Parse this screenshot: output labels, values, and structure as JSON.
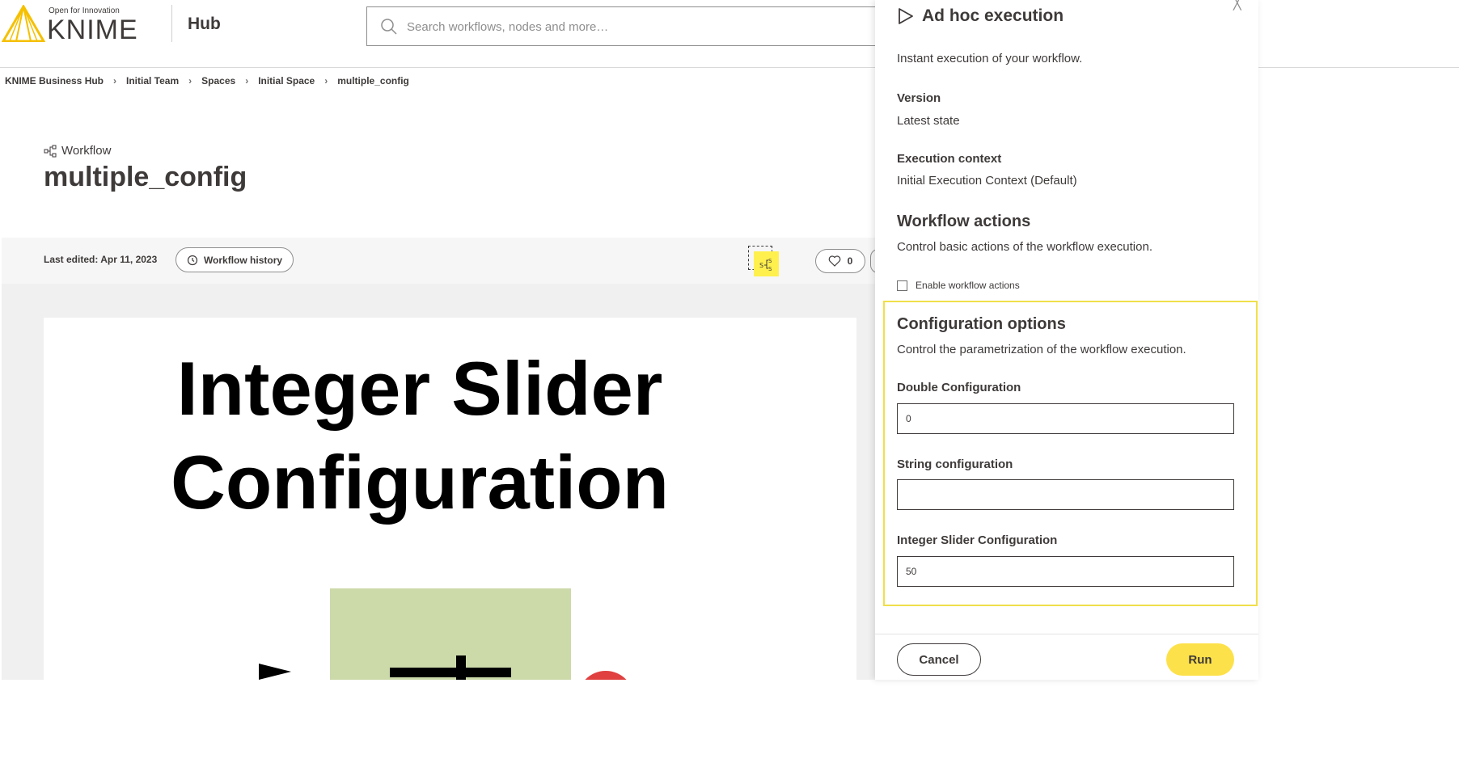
{
  "header": {
    "logo_tagline": "Open for Innovation",
    "logo_word": "KNIME",
    "hub_label": "Hub",
    "search_placeholder": "Search workflows, nodes and more…"
  },
  "breadcrumb": [
    "KNIME Business Hub",
    "Initial Team",
    "Spaces",
    "Initial Space",
    "multiple_config"
  ],
  "item": {
    "type": "Workflow",
    "title": "multiple_config",
    "last_edited": "Last edited: Apr 11, 2023",
    "history_label": "Workflow history",
    "likes": "0"
  },
  "preview": {
    "line1": "Integer Slider",
    "line2": "Configuration"
  },
  "panel": {
    "title": "Ad hoc execution",
    "subtitle": "Instant execution of your workflow.",
    "version_label": "Version",
    "version_value": "Latest state",
    "context_label": "Execution context",
    "context_value": "Initial Execution Context (Default)",
    "actions_title": "Workflow actions",
    "actions_desc": "Control basic actions of the workflow execution.",
    "actions_checkbox": "Enable workflow actions",
    "config_title": "Configuration options",
    "config_desc": "Control the parametrization of the workflow execution.",
    "fields": [
      {
        "label": "Double Configuration",
        "value": "0"
      },
      {
        "label": "String configuration",
        "value": ""
      },
      {
        "label": "Integer Slider Configuration",
        "value": "50"
      }
    ],
    "cancel_label": "Cancel",
    "run_label": "Run"
  },
  "colors": {
    "accent_yellow": "#fde14a",
    "highlight_border": "#f0df4a",
    "text": "#3e3a39"
  }
}
